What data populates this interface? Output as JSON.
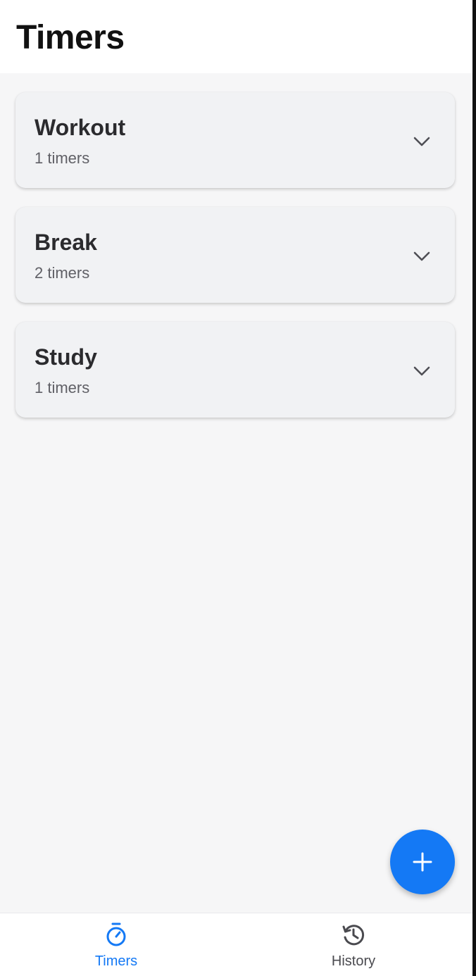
{
  "header": {
    "title": "Timers"
  },
  "groups": [
    {
      "name": "Workout",
      "count_label": "1 timers",
      "icon": "chevron-down-icon"
    },
    {
      "name": "Break",
      "count_label": "2 timers",
      "icon": "chevron-down-icon"
    },
    {
      "name": "Study",
      "count_label": "1 timers",
      "icon": "chevron-down-icon"
    }
  ],
  "fab": {
    "icon": "plus-icon",
    "color": "#1479f5"
  },
  "tabbar": {
    "active_color": "#1479f5",
    "inactive_color": "#4a4a4f",
    "tabs": [
      {
        "label": "Timers",
        "icon": "stopwatch-icon",
        "active": true
      },
      {
        "label": "History",
        "icon": "history-icon",
        "active": false
      }
    ]
  }
}
